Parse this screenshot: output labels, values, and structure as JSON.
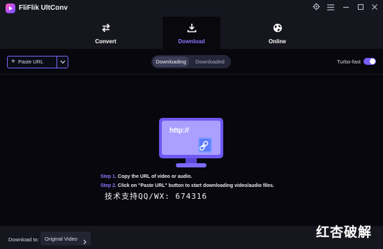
{
  "app": {
    "title": "FliFlik UltConv"
  },
  "nav": {
    "tabs": [
      {
        "label": "Convert",
        "icon": "convert-arrows-icon"
      },
      {
        "label": "Download",
        "icon": "download-icon",
        "active": true
      },
      {
        "label": "Online",
        "icon": "globe-icon"
      }
    ]
  },
  "toolbar": {
    "paste_url_label": "Paste URL",
    "segments": [
      "Downloading",
      "Downloaded"
    ],
    "active_segment": "Downloading",
    "turbo_label": "Turbo-fast",
    "turbo_on": true
  },
  "illustration": {
    "url_text": "http://",
    "icon": "link-icon"
  },
  "steps": [
    {
      "number": "Step 1.",
      "text": " Copy the URL of video or audio."
    },
    {
      "number": "Step 2.",
      "text": " Click on \"Paste URL\" button to start downloading video/audio files."
    }
  ],
  "watermark_text": "技术支持QQ/WX: 674316",
  "watermark_logo": "红杏破解",
  "bottom": {
    "download_to_label": "Download to:",
    "download_to_value": "Original Video"
  },
  "colors": {
    "accent": "#7a68ff",
    "background": "#07070d",
    "panel": "#16161f"
  }
}
